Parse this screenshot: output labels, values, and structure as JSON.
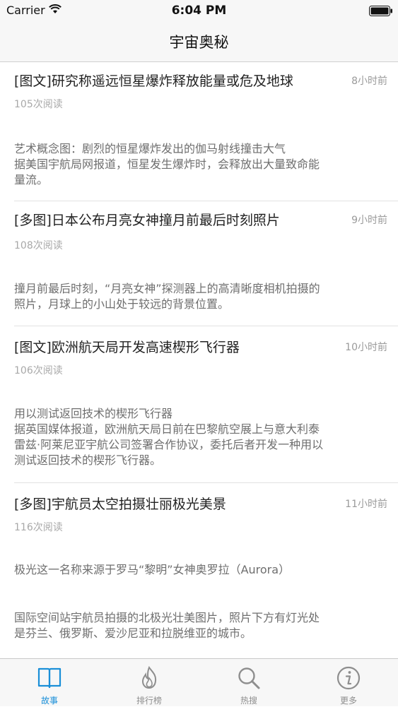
{
  "status_bar": {
    "carrier": "Carrier",
    "time": "6:04 PM",
    "icons": [
      "wifi-icon",
      "battery-icon"
    ]
  },
  "nav": {
    "title": "宇宙奥秘"
  },
  "articles": [
    {
      "title": "[图文]研究称遥远恒星爆炸释放能量或危及地球",
      "time": "8小时前",
      "reads": "105次阅读",
      "summary_lines": [
        "艺术概念图：剧烈的恒星爆炸发出的伽马射线撞击大气",
        "据美国宇航局网报道，恒星发生爆炸时，会释放出大量致命能",
        "量流。"
      ]
    },
    {
      "title": "[多图]日本公布月亮女神撞月前最后时刻照片",
      "time": "9小时前",
      "reads": "108次阅读",
      "summary_lines": [
        "撞月前最后时刻，“月亮女神”探测器上的高清晰度相机拍摄的",
        "照片，月球上的小山处于较远的背景位置。"
      ]
    },
    {
      "title": "[图文]欧洲航天局开发高速楔形飞行器",
      "time": "10小时前",
      "reads": "106次阅读",
      "summary_lines": [
        "用以测试返回技术的楔形飞行器",
        "据英国媒体报道，欧洲航天局日前在巴黎航空展上与意大利泰",
        "雷兹·阿莱尼亚宇航公司签署合作协议，委托后者开发一种用以",
        "测试返回技术的楔形飞行器。"
      ]
    },
    {
      "title": "[多图]宇航员太空拍摄壮丽极光美景",
      "time": "11小时前",
      "reads": "116次阅读",
      "summary_lines": [
        "极光这一名称来源于罗马“黎明”女神奥罗拉（Aurora）",
        "",
        "国际空间站宇航员拍摄的北极光壮美图片，照片下方有灯光处",
        "是芬兰、俄罗斯、爱沙尼亚和拉脱维亚的城市。"
      ]
    }
  ],
  "tabs": [
    {
      "label": "故事",
      "icon": "book-icon",
      "active": true
    },
    {
      "label": "排行榜",
      "icon": "flame-icon",
      "active": false
    },
    {
      "label": "热搜",
      "icon": "search-icon",
      "active": false
    },
    {
      "label": "更多",
      "icon": "info-icon",
      "active": false
    }
  ],
  "colors": {
    "accent": "#1a8fd8",
    "inactive": "#8e8e8e",
    "bar_background": "#f7f7f7"
  }
}
